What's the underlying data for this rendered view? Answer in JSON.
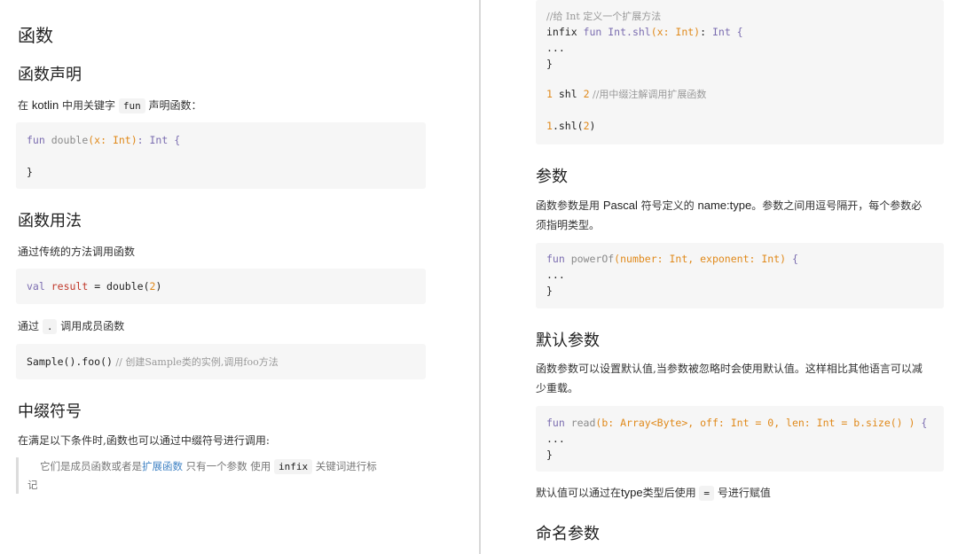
{
  "left": {
    "title": "函数",
    "declaration": {
      "heading": "函数声明",
      "text_pre": "在 ",
      "text_kotlin": "kotlin",
      "text_mid": " 中用关键字 ",
      "keyword": "fun",
      "text_post": " 声明函数：",
      "code": {
        "line1": {
          "kw": "fun",
          "name": " double",
          "params": "(x: Int)",
          "colon": ": ",
          "type": "Int",
          "brace": " {"
        },
        "line2": "}"
      }
    },
    "usage": {
      "heading": "函数用法",
      "text1": "通过传统的方法调用函数",
      "code1": {
        "kw": "val",
        "var": "result",
        "eq": " = double(",
        "num": "2",
        "close": ")"
      },
      "text2_pre": "通过 ",
      "text2_code": ".",
      "text2_post": " 调用成员函数",
      "code2": {
        "call": "Sample().foo()",
        "comment": " // 创建Sample类的实例,调用foo方法"
      }
    },
    "infix": {
      "heading": "中缀符号",
      "text": "在满足以下条件时,函数也可以通过中缀符号进行调用:",
      "quote_pre": "它们是成员函数或者是",
      "quote_link": "扩展函数",
      "quote_mid": "  只有一个参数 使用 ",
      "quote_code": "infix",
      "quote_post": " 关键词进行标",
      "quote_line2": "记"
    }
  },
  "right": {
    "code_top": {
      "line1": "//给 Int 定义一个扩展方法",
      "line2": {
        "kw1": "infix",
        "kw2": " fun ",
        "recv": "Int.shl",
        "params": "(x: Int)",
        "colon": ": ",
        "type": "Int",
        "brace": " {"
      },
      "line3": "...",
      "line4": "}",
      "line5": {
        "num1": "1",
        "op": " shl ",
        "num2": "2",
        "comment": " //用中缀注解调用扩展函数"
      },
      "line6": {
        "num": "1",
        "call": ".shl(",
        "arg": "2",
        "close": ")"
      }
    },
    "params": {
      "heading": "参数",
      "text_pre": "函数参数是用 ",
      "pascal": "Pascal",
      "text_mid": " 符号定义的  ",
      "nametype": "name:type",
      "text_post": "。参数之间用逗号隔开，每个参数必",
      "text_line2": "须指明类型。",
      "code": {
        "line1": {
          "kw": "fun",
          "name": " powerOf",
          "params": "(number: Int, exponent: Int)",
          "brace": " {"
        },
        "line2": "...",
        "line3": "}"
      }
    },
    "defaults": {
      "heading": "默认参数",
      "text_line1": "函数参数可以设置默认值,当参数被忽略时会使用默认值。这样相比其他语言可以减",
      "text_line2": "少重载。",
      "code": {
        "line1": {
          "kw": "fun",
          "name": " read",
          "params": "(b: Array<Byte>, off: Int = 0, len: Int = b.size() )",
          "brace": " {"
        },
        "line2": "...",
        "line3": "}"
      },
      "note_pre": "默认值可以通过在",
      "note_type": "type",
      "note_mid": "类型后使用 ",
      "note_code": "=",
      "note_post": " 号进行赋值"
    },
    "named": {
      "heading": "命名参数"
    }
  }
}
